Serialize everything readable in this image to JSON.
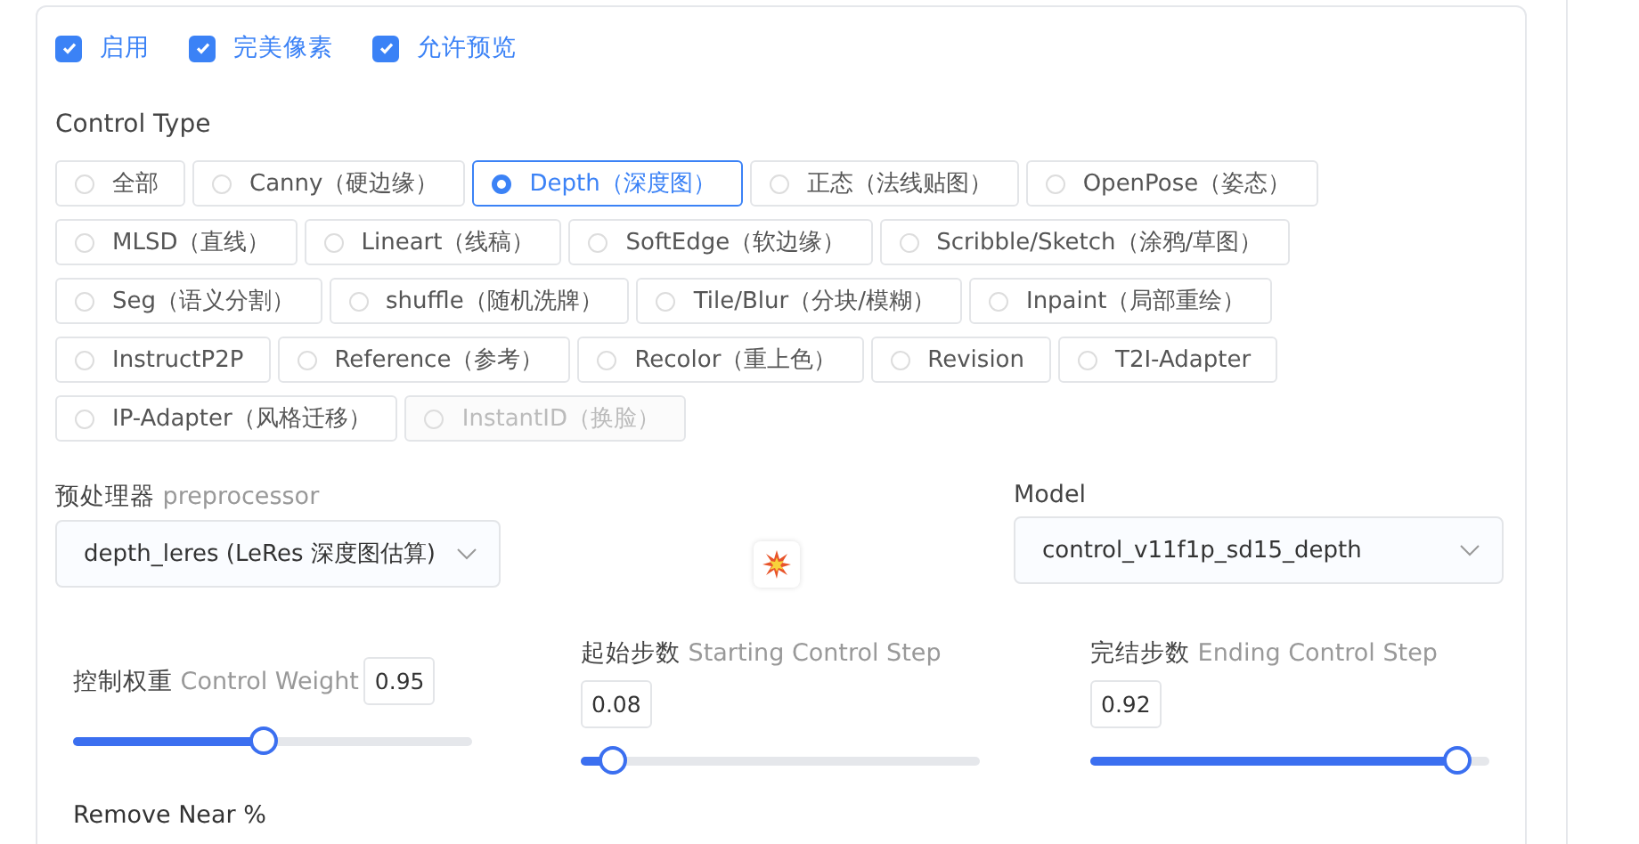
{
  "checkboxes": [
    {
      "label": "启用",
      "checked": true
    },
    {
      "label": "完美像素",
      "checked": true
    },
    {
      "label": "允许预览",
      "checked": true
    }
  ],
  "control_type": {
    "label": "Control Type",
    "options": [
      {
        "label": "全部",
        "selected": false,
        "disabled": false
      },
      {
        "label": "Canny（硬边缘）",
        "selected": false,
        "disabled": false
      },
      {
        "label": "Depth（深度图）",
        "selected": true,
        "disabled": false
      },
      {
        "label": "正态（法线贴图）",
        "selected": false,
        "disabled": false
      },
      {
        "label": "OpenPose（姿态）",
        "selected": false,
        "disabled": false
      },
      {
        "label": "MLSD（直线）",
        "selected": false,
        "disabled": false
      },
      {
        "label": "Lineart（线稿）",
        "selected": false,
        "disabled": false
      },
      {
        "label": "SoftEdge（软边缘）",
        "selected": false,
        "disabled": false
      },
      {
        "label": "Scribble/Sketch（涂鸦/草图）",
        "selected": false,
        "disabled": false
      },
      {
        "label": "Seg（语义分割）",
        "selected": false,
        "disabled": false
      },
      {
        "label": "shuffle（随机洗牌）",
        "selected": false,
        "disabled": false
      },
      {
        "label": "Tile/Blur（分块/模糊）",
        "selected": false,
        "disabled": false
      },
      {
        "label": "Inpaint（局部重绘）",
        "selected": false,
        "disabled": false
      },
      {
        "label": "InstructP2P",
        "selected": false,
        "disabled": false
      },
      {
        "label": "Reference（参考）",
        "selected": false,
        "disabled": false
      },
      {
        "label": "Recolor（重上色）",
        "selected": false,
        "disabled": false
      },
      {
        "label": "Revision",
        "selected": false,
        "disabled": false
      },
      {
        "label": "T2I-Adapter",
        "selected": false,
        "disabled": false
      },
      {
        "label": "IP-Adapter（风格迁移）",
        "selected": false,
        "disabled": false
      },
      {
        "label": "InstantID（换脸）",
        "selected": false,
        "disabled": true
      }
    ]
  },
  "preprocessor": {
    "label_cn": "预处理器",
    "label_en": "preprocessor",
    "value": "depth_leres (LeRes 深度图估算)"
  },
  "model": {
    "label": "Model",
    "value": "control_v11f1p_sd15_depth"
  },
  "sliders": [
    {
      "label_cn": "控制权重",
      "label_en": "Control Weight",
      "value": "0.95",
      "level": 0.476,
      "inline": true
    },
    {
      "label_cn": "起始步数",
      "label_en": "Starting Control Step",
      "value": "0.08",
      "level": 0.08,
      "inline": false
    },
    {
      "label_cn": "完结步数",
      "label_en": "Ending Control Step",
      "value": "0.92",
      "level": 0.92,
      "inline": false
    }
  ],
  "remove_near": {
    "label": "Remove Near %"
  }
}
